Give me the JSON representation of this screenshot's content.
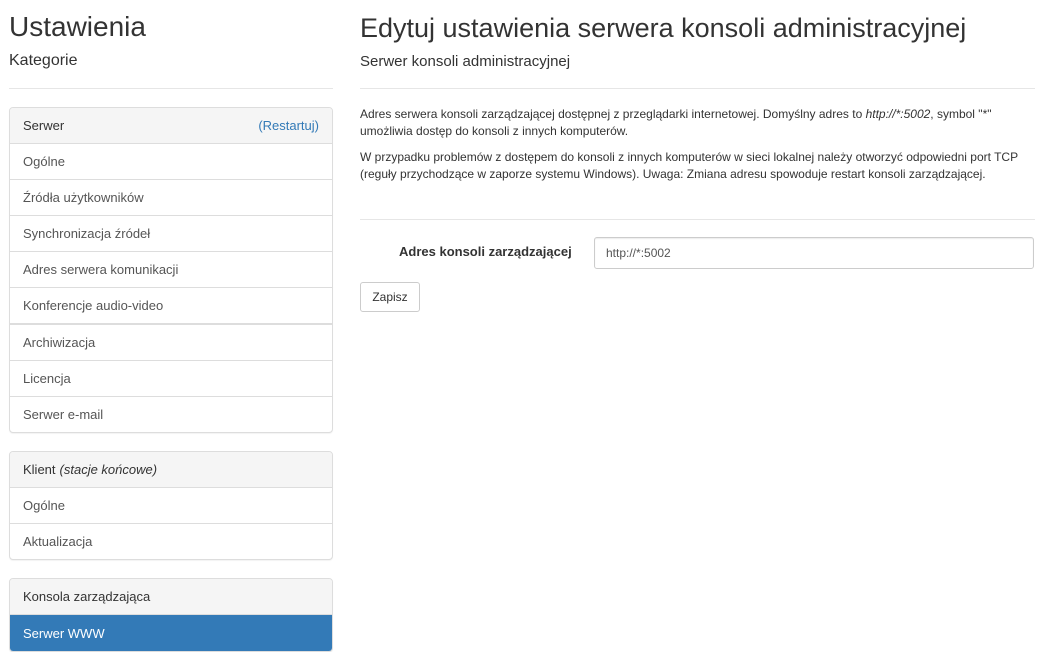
{
  "sidebar": {
    "title": "Ustawienia",
    "subtitle": "Kategorie",
    "panel_server": {
      "heading": "Serwer",
      "restart_link": "(Restartuj)",
      "items": [
        "Ogólne",
        "Źródła użytkowników",
        "Synchronizacja źródeł",
        "Adres serwera komunikacji",
        "Konferencje audio-video",
        "Archiwizacja",
        "Licencja",
        "Serwer e-mail"
      ]
    },
    "panel_client": {
      "heading": "Klient",
      "heading_note": "(stacje końcowe)",
      "items": [
        "Ogólne",
        "Aktualizacja"
      ]
    },
    "panel_console": {
      "heading": "Konsola zarządzająca",
      "items": [
        "Serwer WWW"
      ],
      "active_item": "Serwer WWW"
    }
  },
  "main": {
    "title": "Edytuj ustawienia serwera konsoli administracyjnej",
    "subtitle": "Serwer konsoli administracyjnej",
    "description1_part1": "Adres serwera konsoli zarządzającej dostępnej z przeglądarki internetowej. Domyślny adres to ",
    "description1_code": "http://*:5002",
    "description1_part2": ", symbol \"*\" umożliwia dostęp do konsoli z innych komputerów.",
    "description2": "W przypadku problemów z dostępem do konsoli z innych komputerów w sieci lokalnej należy otworzyć odpowiedni port TCP (reguły przychodzące w zaporze systemu Windows). Uwaga: Zmiana adresu spowoduje restart konsoli zarządzającej.",
    "form": {
      "label": "Adres konsoli zarządzającej",
      "value": "http://*:5002"
    },
    "save_label": "Zapisz"
  },
  "colors": {
    "accent": "#337ab7",
    "panel_heading_bg": "#f5f5f5",
    "border": "#dddddd"
  }
}
